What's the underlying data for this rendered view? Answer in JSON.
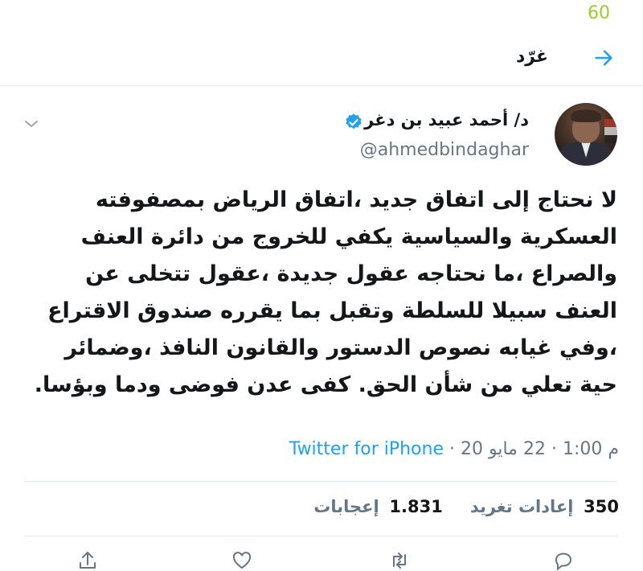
{
  "status": {
    "number": "60"
  },
  "header": {
    "title": "غرّد"
  },
  "tweet": {
    "author": {
      "name": "د/ أحمد عبيد بن دغر",
      "handle": "@ahmedbindaghar"
    },
    "text": "لا نحتاج إلى اتفاق جديد ،اتفاق الرياض بمصفوفته العسكرية والسياسية يكفي للخروج من دائرة العنف والصراع ،ما نحتاجه عقول جديدة ،عقول تتخلى عن العنف سبيلا للسلطة وتقبل بما يقرره صندوق الاقتراع ،وفي غيابه نصوص الدستور والقانون النافذ ،وضمائر حية تعلي من شأن الحق. كفى عدن فوضى ودما وبؤسا.",
    "time": "1:00 م",
    "date": "22 مايو 20",
    "separator": "·",
    "source": "Twitter for iPhone"
  },
  "stats": {
    "retweets": {
      "count": "350",
      "label": "إعادات تغريد"
    },
    "likes": {
      "count": "1.831",
      "label": "إعجابات"
    }
  },
  "colors": {
    "accent": "#1da1f2",
    "muted": "#657786",
    "status": "#9acd32"
  }
}
